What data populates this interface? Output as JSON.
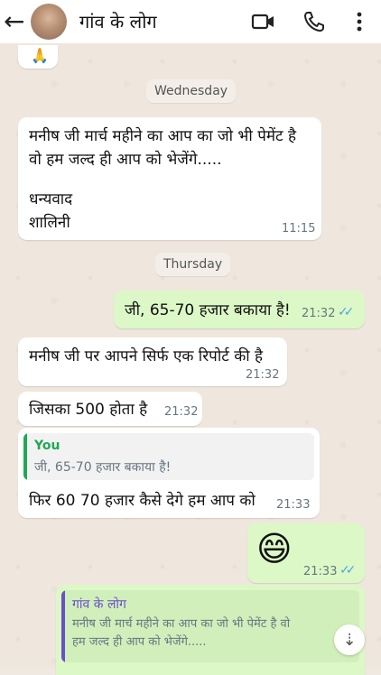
{
  "header": {
    "title": "गांव के लोग"
  },
  "messages": {
    "m0_emoji": "🙏",
    "date_wed": "Wednesday",
    "m1_line1": "मनीष जी मार्च महीने का आप का जो भी पेमेंट है",
    "m1_line2": "वो हम जल्द ही आप को भेजेंगे.....",
    "m1_line3": "धन्यवाद",
    "m1_line4": "शालिनी",
    "m1_time": "11:15",
    "date_thu": "Thursday",
    "m2_text": "जी, 65-70 हजार बकाया है!",
    "m2_time": "21:32",
    "m3_text": "मनीष जी पर आपने सिर्फ एक रिपोर्ट की है",
    "m3_time": "21:32",
    "m4_text": "जिसका 500 होता है",
    "m4_time": "21:32",
    "m5_quote_author": "You",
    "m5_quote_text": "जी, 65-70 हजार बकाया है!",
    "m5_text": "फिर 60 70 हजार कैसे देगे हम आप को",
    "m5_time": "21:33",
    "m6_emoji": "😄",
    "m6_time": "21:33",
    "m7_quote_author": "गांव के लोग",
    "m7_quote_line1": "मनीष जी मार्च महीने का आप का जो भी पेमेंट है वो",
    "m7_quote_line2": "हम जल्द ही आप को भेजेंगे....."
  },
  "colors": {
    "outgoing_bubble": "#dcf8c6",
    "incoming_bubble": "#ffffff",
    "quote_you": "#1fa855",
    "quote_group": "#6a4fc7",
    "read_ticks": "#4fa6e6"
  },
  "icons": [
    "back-arrow-icon",
    "video-call-icon",
    "phone-icon",
    "more-options-icon",
    "double-check-icon",
    "scroll-down-icon"
  ]
}
